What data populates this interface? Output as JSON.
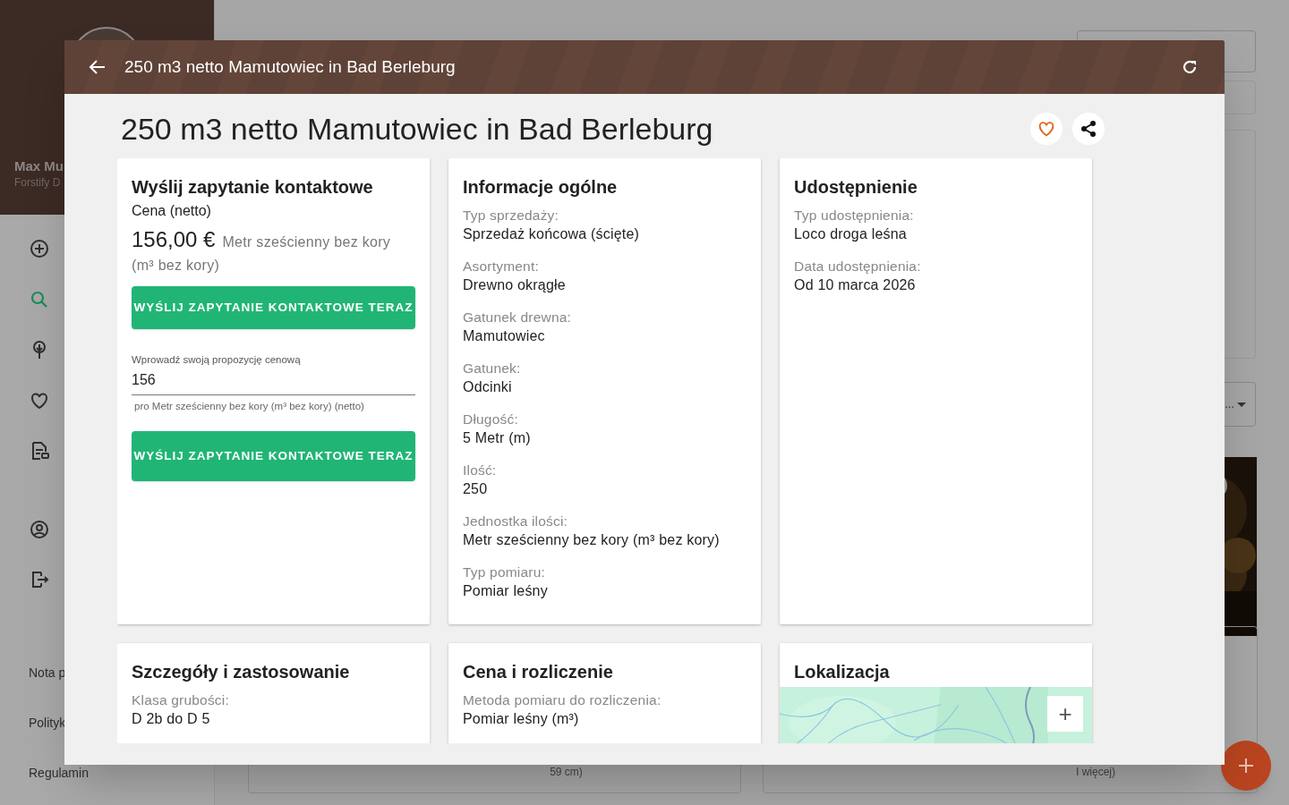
{
  "sidebar": {
    "user_name": "Max Mu",
    "company": "Forstify D",
    "nav": [
      {
        "selected": false
      },
      {
        "selected": true
      },
      {
        "selected": false
      },
      {
        "selected": false
      },
      {
        "selected": false
      },
      {
        "selected": false
      },
      {
        "selected": false
      }
    ],
    "footer_links": [
      "Nota p",
      "Polityk",
      "Regulamin"
    ]
  },
  "background": {
    "dropdown_value": "...",
    "card_texts": [
      "59 cm)",
      "I więcej)"
    ]
  },
  "dialog": {
    "title_bar": {
      "title": "250 m3 netto Mamutowiec in Bad Berleburg"
    },
    "heading": "250 m3 netto Mamutowiec in Bad Berleburg",
    "favorite": false,
    "cards": [
      {
        "kind": "contact",
        "title": "Wyślij zapytanie kontaktowe",
        "price_label": "Cena (netto)",
        "price": "156,00 €",
        "unit": "Metr sześcienny bez kory (m³ bez kory)",
        "button": "WYŚLIJ ZAPYTANIE KONTAKTOWE TERAZ",
        "offer_field": {
          "label": "Wprowadź swoją propozycję cenową",
          "value": "156",
          "helper": "pro Metr sześcienny bez kory (m³ bez kory) (netto)"
        },
        "button_2": "WYŚLIJ ZAPYTANIE KONTAKTOWE TERAZ"
      },
      {
        "kind": "fields",
        "title": "Informacje ogólne",
        "fields": [
          {
            "label": "Typ sprzedaży:",
            "value": "Sprzedaż końcowa (ścięte)"
          },
          {
            "label": "Asortyment:",
            "value": "Drewno okrągłe"
          },
          {
            "label": "Gatunek drewna:",
            "value": "Mamutowiec"
          },
          {
            "label": "Gatunek:",
            "value": "Odcinki"
          },
          {
            "label": "Długość:",
            "value": "5 Metr (m)"
          },
          {
            "label": "Ilość:",
            "value": "250"
          },
          {
            "label": "Jednostka ilości:",
            "value": "Metr sześcienny bez kory (m³ bez kory)"
          },
          {
            "label": "Typ pomiaru:",
            "value": "Pomiar leśny"
          }
        ]
      },
      {
        "kind": "fields",
        "title": "Udostępnienie",
        "fields": [
          {
            "label": "Typ udostępnienia:",
            "value": "Loco droga leśna"
          },
          {
            "label": "Data udostępnienia:",
            "value": "Od 10 marca 2026"
          }
        ]
      },
      {
        "kind": "fields",
        "title": "Szczegóły i zastosowanie",
        "fields": [
          {
            "label": "Klasa grubości:",
            "value": "D 2b do D 5"
          }
        ]
      },
      {
        "kind": "fields",
        "title": "Cena i rozliczenie",
        "fields": [
          {
            "label": "Metoda pomiaru do rozliczenia:",
            "value": "Pomiar leśny (m³)"
          }
        ]
      },
      {
        "kind": "map",
        "title": "Lokalizacja",
        "zoom_in": "+"
      }
    ]
  }
}
